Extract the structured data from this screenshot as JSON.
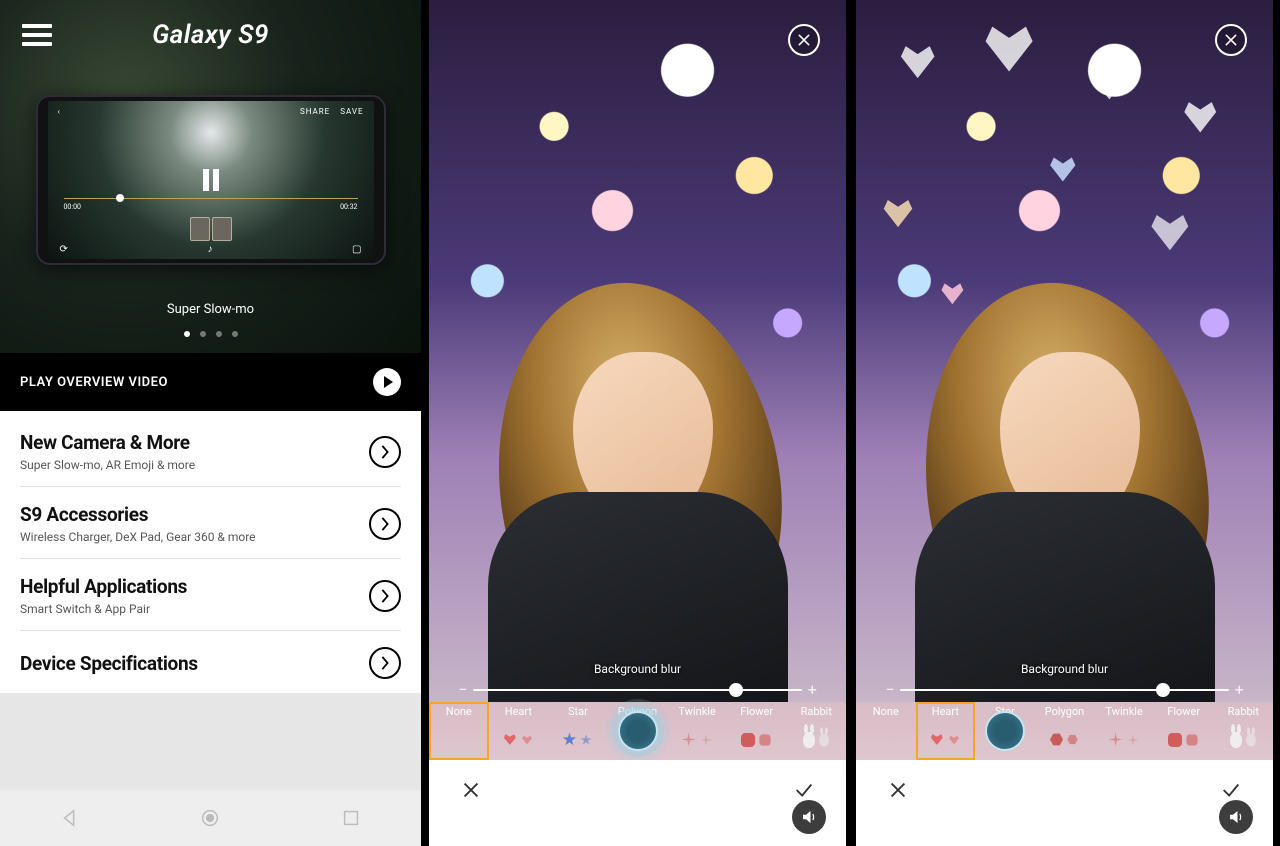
{
  "menu_panel": {
    "title": "Galaxy S9",
    "hero_caption": "Super Slow-mo",
    "phone": {
      "share": "SHARE",
      "save": "SAVE",
      "time_start": "00:00",
      "time_end": "00:32"
    },
    "dots_active_index": 0,
    "dots_count": 4,
    "overview_label": "PLAY OVERVIEW VIDEO",
    "items": [
      {
        "title": "New Camera & More",
        "subtitle": "Super Slow-mo, AR Emoji & more"
      },
      {
        "title": "S9 Accessories",
        "subtitle": "Wireless Charger, DeX Pad, Gear 360 & more"
      },
      {
        "title": "Helpful Applications",
        "subtitle": "Smart Switch & App Pair"
      },
      {
        "title": "Device Specifications",
        "subtitle": ""
      }
    ]
  },
  "editor": {
    "blur_label": "Background blur",
    "slider_value_pct": 80,
    "effects": [
      "None",
      "Heart",
      "Star",
      "Polygon",
      "Twinkle",
      "Flower",
      "Rabbit"
    ],
    "panel2_selected_index": 0,
    "panel3_selected_index": 1
  },
  "colors": {
    "accent_orange": "#f5a623"
  }
}
